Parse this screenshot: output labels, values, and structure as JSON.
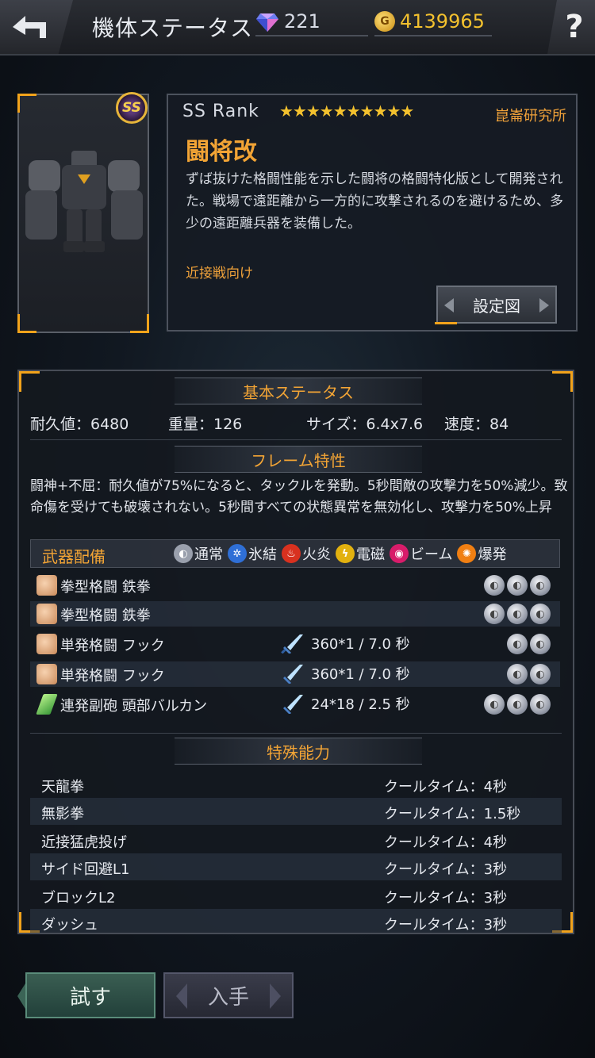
{
  "header": {
    "title": "機体ステータス",
    "gems": "221",
    "coins": "4139965",
    "help_label": "?"
  },
  "mech": {
    "rank_badge": "SS",
    "rank_label": "SS Rank",
    "stars": "★★★★★★★★★★",
    "star_count": 10,
    "maker": "崑崙研究所",
    "name": "闘将改",
    "description": "ずば抜けた格闘性能を示した闘将の格闘特化版として開発された。戦場で遠距離から一方的に攻撃されるのを避けるため、多少の遠距離兵器を装備した。",
    "tag": "近接戦向け",
    "blueprint_button": "設定図"
  },
  "basic_status": {
    "header": "基本ステータス",
    "durability": "耐久値：6480",
    "weight": "重量：126",
    "size": "サイズ：6.4x7.6",
    "speed": "速度：84"
  },
  "frame": {
    "header": "フレーム特性",
    "text": "闘神+不屈：耐久値が75%になると、タックルを発動。5秒間敵の攻撃力を50%減少。致命傷を受けても破壊されない。5秒間すべての状態異常を無効化し、攻撃力を50%上昇"
  },
  "weapons": {
    "header": "武器配備",
    "legend": [
      {
        "label": "通常",
        "icon": "normal-icon",
        "color": "#9aa0ad"
      },
      {
        "label": "氷結",
        "icon": "ice-icon",
        "color": "#2f6fd6"
      },
      {
        "label": "火炎",
        "icon": "fire-icon",
        "color": "#d8311f"
      },
      {
        "label": "電磁",
        "icon": "electric-icon",
        "color": "#e2b10f"
      },
      {
        "label": "ビーム",
        "icon": "beam-icon",
        "color": "#d81c6a"
      },
      {
        "label": "爆発",
        "icon": "explosion-icon",
        "color": "#f07f12"
      }
    ],
    "rows": [
      {
        "name": "拳型格闘 鉄拳",
        "damage": "",
        "slots": 3,
        "icon": "fist-icon"
      },
      {
        "name": "拳型格闘 鉄拳",
        "damage": "",
        "slots": 3,
        "icon": "fist-icon"
      },
      {
        "name": "単発格闘 フック",
        "damage": "360*1 / 7.0 秒",
        "slots": 2,
        "icon": "fist-icon"
      },
      {
        "name": "単発格闘 フック",
        "damage": "360*1 / 7.0 秒",
        "slots": 2,
        "icon": "fist-icon"
      },
      {
        "name": "連発副砲 頭部バルカン",
        "damage": "24*18 / 2.5 秒",
        "slots": 3,
        "icon": "gun-icon"
      }
    ]
  },
  "abilities": {
    "header": "特殊能力",
    "rows": [
      {
        "name": "天龍拳",
        "cooldown": "クールタイム：4秒"
      },
      {
        "name": "無影拳",
        "cooldown": "クールタイム：1.5秒"
      },
      {
        "name": "近接猛虎投げ",
        "cooldown": "クールタイム：4秒"
      },
      {
        "name": "サイド回避L1",
        "cooldown": "クールタイム：3秒"
      },
      {
        "name": "ブロックL2",
        "cooldown": "クールタイム：3秒"
      },
      {
        "name": "ダッシュ",
        "cooldown": "クールタイム：3秒"
      }
    ]
  },
  "footer": {
    "try_button": "試す",
    "get_button": "入手"
  }
}
